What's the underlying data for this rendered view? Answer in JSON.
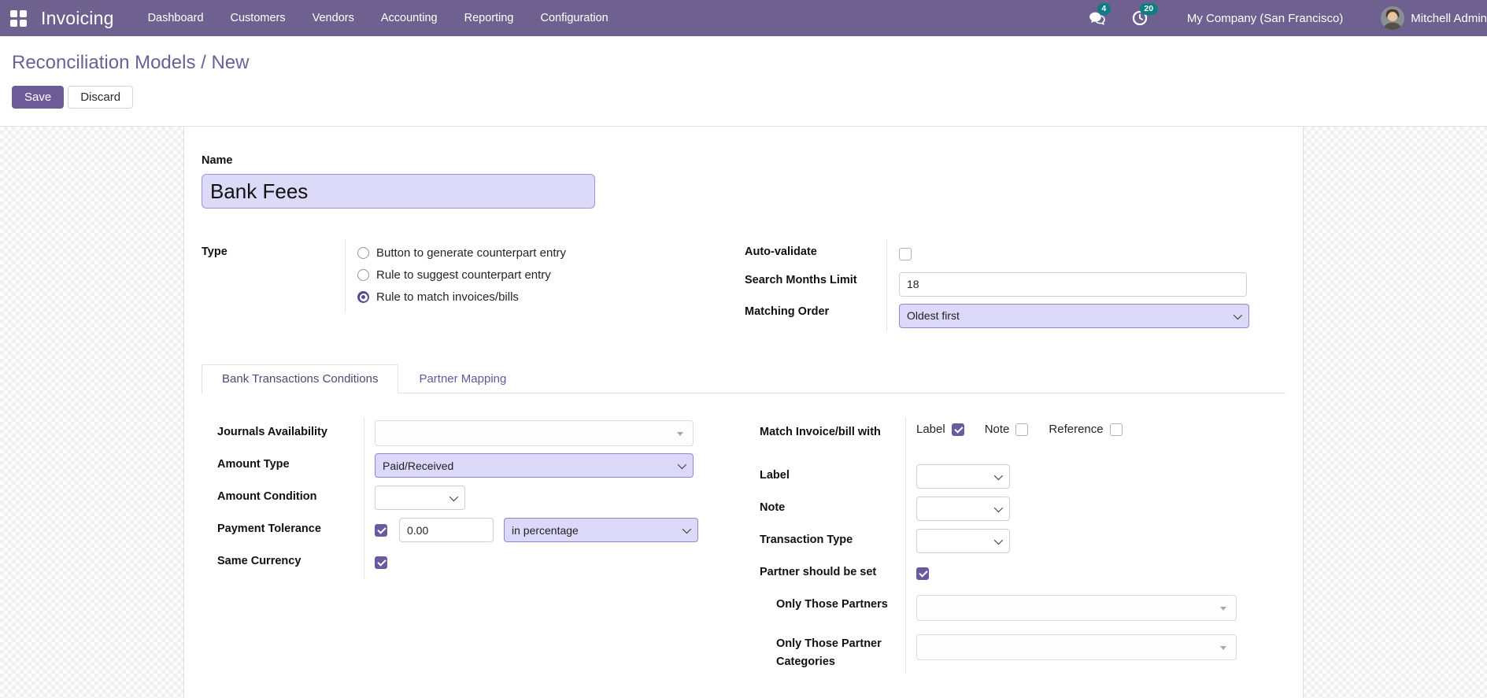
{
  "colors": {
    "navbar_bg": "#6e6190",
    "badge_teal": "#0b7e83",
    "primary_purple": "#6e5c99",
    "field_lavender": "#dbd8f9",
    "breadcrumb_purple": "#6c5f96"
  },
  "navbar": {
    "brand": "Invoicing",
    "menu_items": [
      "Dashboard",
      "Customers",
      "Vendors",
      "Accounting",
      "Reporting",
      "Configuration"
    ],
    "messages_badge": "4",
    "activities_badge": "20",
    "company": "My Company (San Francisco)",
    "user": "Mitchell Admin"
  },
  "control_panel": {
    "breadcrumb_parent": "Reconciliation Models",
    "breadcrumb_separator": " / ",
    "breadcrumb_current": "New",
    "save_label": "Save",
    "discard_label": "Discard"
  },
  "form": {
    "name_label": "Name",
    "name_value": "Bank Fees",
    "type": {
      "label": "Type",
      "options": [
        {
          "label": "Button to generate counterpart entry",
          "selected": false
        },
        {
          "label": "Rule to suggest counterpart entry",
          "selected": false
        },
        {
          "label": "Rule to match invoices/bills",
          "selected": true
        }
      ]
    },
    "auto_validate": {
      "label": "Auto-validate",
      "checked": false
    },
    "search_months_limit": {
      "label": "Search Months Limit",
      "value": "18"
    },
    "matching_order": {
      "label": "Matching Order",
      "value": "Oldest first"
    },
    "tabs": [
      {
        "label": "Bank Transactions Conditions",
        "active": true
      },
      {
        "label": "Partner Mapping",
        "active": false
      }
    ],
    "conditions": {
      "journals_availability": {
        "label": "Journals Availability",
        "value": ""
      },
      "amount_type": {
        "label": "Amount Type",
        "value": "Paid/Received"
      },
      "amount_condition": {
        "label": "Amount Condition",
        "value": ""
      },
      "payment_tolerance": {
        "label": "Payment Tolerance",
        "checked": true,
        "value": "0.00",
        "unit": "in percentage"
      },
      "same_currency": {
        "label": "Same Currency",
        "checked": true
      },
      "match_with": {
        "label": "Match Invoice/bill with",
        "options": [
          {
            "label": "Label",
            "checked": true
          },
          {
            "label": "Note",
            "checked": false
          },
          {
            "label": "Reference",
            "checked": false
          }
        ]
      },
      "label_field": {
        "label": "Label",
        "value": ""
      },
      "note_field": {
        "label": "Note",
        "value": ""
      },
      "transaction_type": {
        "label": "Transaction Type",
        "value": ""
      },
      "partner_should_be_set": {
        "label": "Partner should be set",
        "checked": true
      },
      "only_those_partners": {
        "label": "Only Those Partners",
        "value": ""
      },
      "only_those_partner_categories": {
        "label": "Only Those Partner Categories",
        "value": ""
      }
    }
  }
}
